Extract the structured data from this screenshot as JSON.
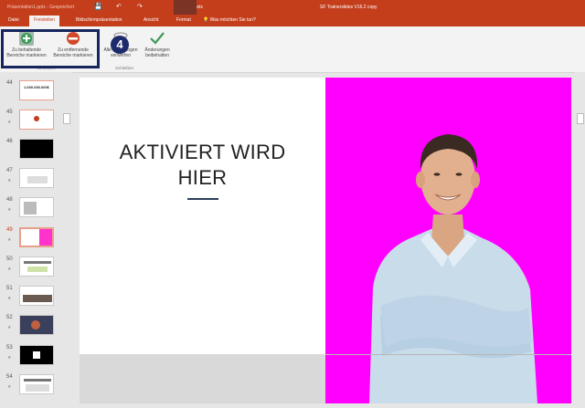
{
  "window": {
    "title": "SF Trainerslides V16.2 copy",
    "left_title": "Präsentation1.pptx - Gespeichert",
    "context_label": "Bildtools"
  },
  "tabs": [
    {
      "label": "Datei"
    },
    {
      "label": "Freistellen"
    },
    {
      "label": "Bildschirmpräsentation"
    },
    {
      "label": "Ansicht"
    },
    {
      "label": "Format"
    }
  ],
  "tell_me": "Was möchten Sie tun?",
  "ribbon": {
    "keep_label": "Zu behaltende Bereiche markieren",
    "remove_label": "Zu entfernende Bereiche markieren",
    "discard_label": "Alle Änderungen verwerfen",
    "keep_changes_label": "Änderungen beibehalten",
    "group_refine": "Verfeinern",
    "group_close": "Schließen"
  },
  "step_badge": "4",
  "slides": [
    {
      "num": "44",
      "text": "1.000.000.000€"
    },
    {
      "num": "45",
      "text": ""
    },
    {
      "num": "46",
      "text": ""
    },
    {
      "num": "47",
      "text": ""
    },
    {
      "num": "48",
      "text": ""
    },
    {
      "num": "49",
      "text": ""
    },
    {
      "num": "50",
      "text": ""
    },
    {
      "num": "51",
      "text": ""
    },
    {
      "num": "52",
      "text": ""
    },
    {
      "num": "53",
      "text": ""
    },
    {
      "num": "54",
      "text": ""
    }
  ],
  "slide": {
    "title_line1": "AKTIVIERT WIRD",
    "title_line2": "HIER"
  },
  "colors": {
    "brand": "#c43e1c",
    "highlight": "#17255e",
    "removal_area": "#ff00ff"
  }
}
